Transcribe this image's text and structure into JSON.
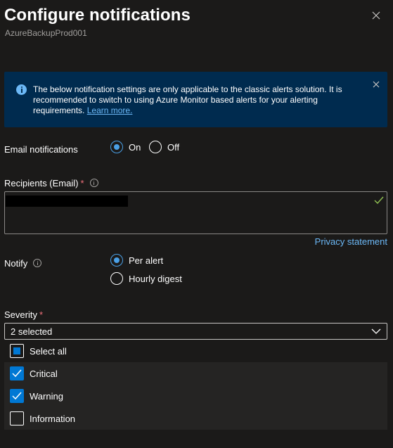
{
  "panel": {
    "title": "Configure notifications",
    "subtitle": "AzureBackupProd001"
  },
  "banner": {
    "message": "The below notification settings are only applicable to the classic alerts solution. It is recommended to switch to using Azure Monitor based alerts for your alerting requirements.",
    "link": "Learn more."
  },
  "email_notifications": {
    "label": "Email notifications",
    "options": [
      "On",
      "Off"
    ],
    "selected": "On"
  },
  "recipients": {
    "label": "Recipients (Email)",
    "required_mark": "*",
    "value": ""
  },
  "privacy_link": "Privacy statement",
  "notify": {
    "label": "Notify",
    "options": [
      "Per alert",
      "Hourly digest"
    ],
    "selected": "Per alert"
  },
  "severity": {
    "label": "Severity",
    "required_mark": "*",
    "selected_text": "2 selected",
    "select_all_label": "Select all",
    "options": [
      {
        "label": "Critical",
        "checked": true
      },
      {
        "label": "Warning",
        "checked": true
      },
      {
        "label": "Information",
        "checked": false
      }
    ]
  },
  "colors": {
    "background": "#1b1a19",
    "banner": "#002b4f",
    "accent": "#0078d4",
    "link": "#6cb8f6",
    "required": "#f1707b",
    "valid": "#92c353"
  }
}
